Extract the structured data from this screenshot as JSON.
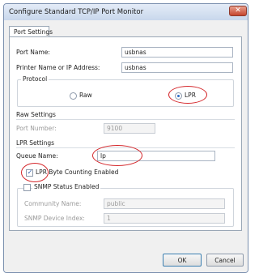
{
  "window": {
    "title": "Configure Standard TCP/IP Port Monitor",
    "close_glyph": "✕"
  },
  "tabs": [
    {
      "label": "Port Settings",
      "active": true
    }
  ],
  "port_name": {
    "label": "Port Name:",
    "value": "usbnas"
  },
  "printer_name": {
    "label": "Printer Name or IP Address:",
    "value": "usbnas"
  },
  "protocol": {
    "title": "Protocol",
    "raw_label": "Raw",
    "lpr_label": "LPR",
    "selected": "LPR"
  },
  "raw_settings": {
    "title": "Raw Settings",
    "port_number_label": "Port Number:",
    "port_number_value": "9100"
  },
  "lpr_settings": {
    "title": "LPR Settings",
    "queue_name_label": "Queue Name:",
    "queue_name_value": "lp",
    "byte_counting_label": "LPR Byte Counting Enabled",
    "byte_counting_checked": true
  },
  "snmp": {
    "status_label": "SNMP Status Enabled",
    "status_checked": false,
    "community_label": "Community Name:",
    "community_value": "public",
    "device_index_label": "SNMP Device Index:",
    "device_index_value": "1"
  },
  "buttons": {
    "ok": "OK",
    "cancel": "Cancel"
  },
  "colors": {
    "highlight_ellipse": "#d4262a",
    "accent": "#2a6bc8"
  }
}
